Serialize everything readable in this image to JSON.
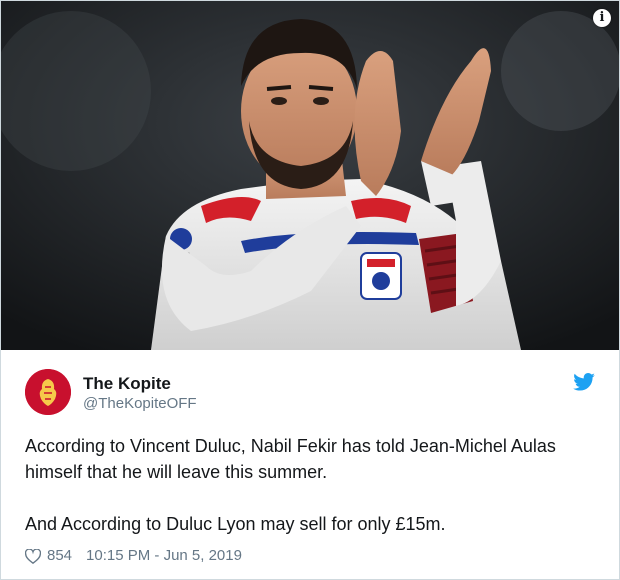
{
  "media": {
    "info_icon": "info-icon",
    "info_symbol": "i"
  },
  "author": {
    "display_name": "The Kopite",
    "handle": "@TheKopiteOFF",
    "avatar_icon": "liverbird-crest-icon",
    "avatar_caption": "THE KOPITE"
  },
  "brand": {
    "icon": "twitter-bird-icon",
    "color": "#1da1f2"
  },
  "tweet": {
    "paragraph_1": "According to Vincent Duluc, Nabil Fekir has told Jean-Michel Aulas himself that he will leave this summer.",
    "paragraph_2": "And According to Duluc Lyon may sell for only £15m."
  },
  "footer": {
    "like_icon": "heart-icon",
    "likes": "854",
    "timestamp": "10:15 PM - Jun 5, 2019"
  }
}
